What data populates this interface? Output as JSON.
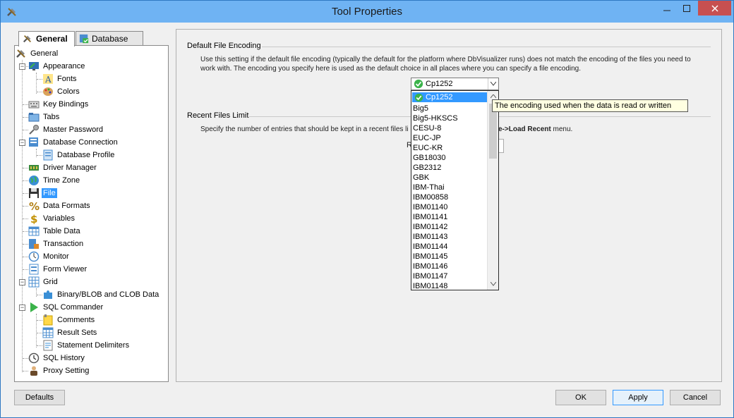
{
  "window": {
    "title": "Tool Properties"
  },
  "tabs": [
    {
      "label": "General"
    },
    {
      "label": "Database"
    }
  ],
  "tree": {
    "items": [
      {
        "label": "General"
      },
      {
        "label": "Appearance"
      },
      {
        "label": "Fonts"
      },
      {
        "label": "Colors"
      },
      {
        "label": "Key Bindings"
      },
      {
        "label": "Tabs"
      },
      {
        "label": "Master Password"
      },
      {
        "label": "Database Connection"
      },
      {
        "label": "Database Profile"
      },
      {
        "label": "Driver Manager"
      },
      {
        "label": "Time Zone"
      },
      {
        "label": "File"
      },
      {
        "label": "Data Formats"
      },
      {
        "label": "Variables"
      },
      {
        "label": "Table Data"
      },
      {
        "label": "Transaction"
      },
      {
        "label": "Monitor"
      },
      {
        "label": "Form Viewer"
      },
      {
        "label": "Grid"
      },
      {
        "label": "Binary/BLOB and CLOB Data"
      },
      {
        "label": "SQL Commander"
      },
      {
        "label": "Comments"
      },
      {
        "label": "Result Sets"
      },
      {
        "label": "Statement Delimiters"
      },
      {
        "label": "SQL History"
      },
      {
        "label": "Proxy Setting"
      }
    ],
    "selected": "File"
  },
  "encoding": {
    "title": "Default File Encoding",
    "desc1": "Use this setting if the default file encoding (typically the default for the platform where DbVisualizer runs) does not match the encoding of the files you need to",
    "desc2": "work with. The encoding you specify here is used as the default choice in all places where you can specify a file encoding.",
    "selected": "Cp1252",
    "options": [
      "Cp1252",
      "Big5",
      "Big5-HKSCS",
      "CESU-8",
      "EUC-JP",
      "EUC-KR",
      "GB18030",
      "GB2312",
      "GBK",
      "IBM-Thai",
      "IBM00858",
      "IBM01140",
      "IBM01141",
      "IBM01142",
      "IBM01143",
      "IBM01144",
      "IBM01145",
      "IBM01146",
      "IBM01147",
      "IBM01148"
    ],
    "tooltip": "The encoding used when the data is read or written"
  },
  "recent": {
    "title": "Recent Files Limit",
    "desc_start": "Specify the number of entries that should be kept in a recent files li",
    "desc_end": "e->Load Recent",
    "desc_tail": " menu.",
    "partial_label": "R"
  },
  "buttons": {
    "defaults": "Defaults",
    "ok": "OK",
    "apply": "Apply",
    "cancel": "Cancel"
  },
  "colors": {
    "accent": "#3399ff",
    "titlebar": "#6fb3f3",
    "close": "#c75050"
  }
}
